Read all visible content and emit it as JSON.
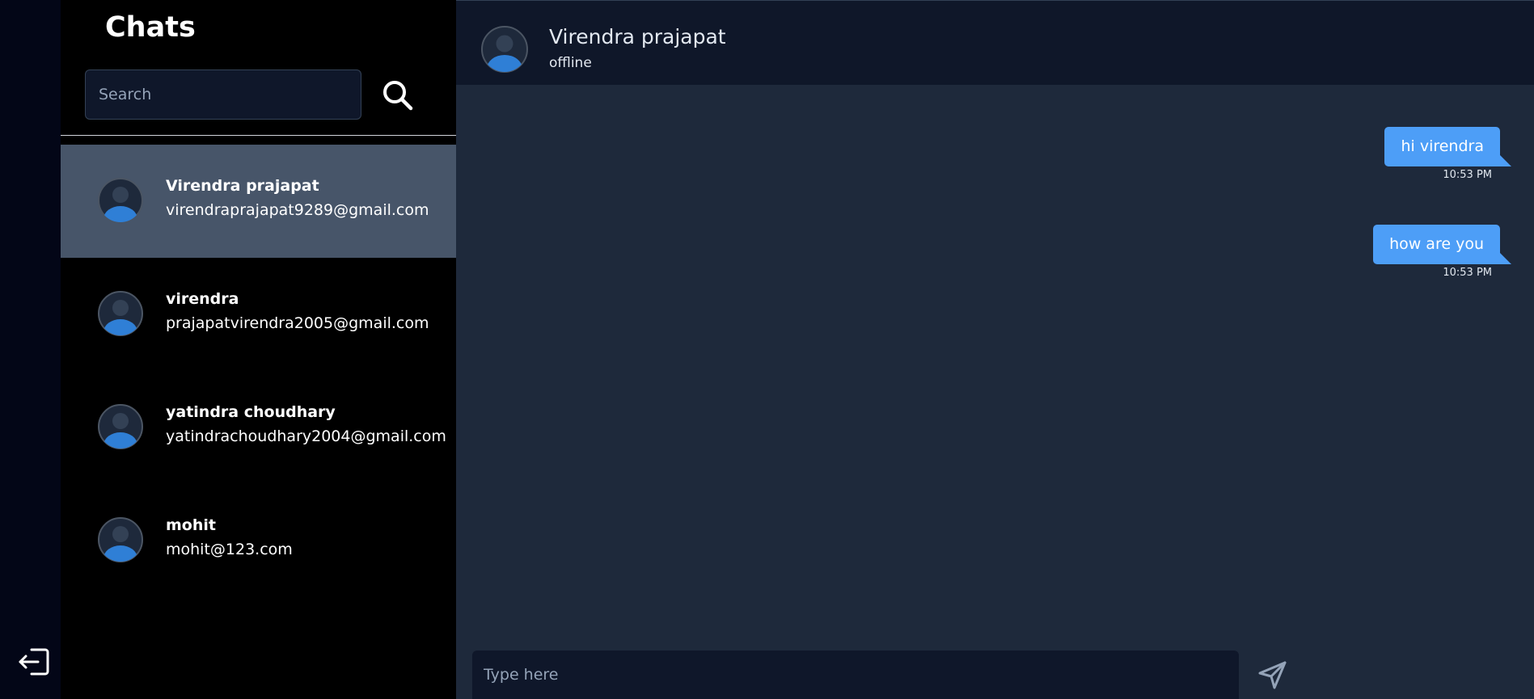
{
  "sidebar": {
    "title": "Chats",
    "search_placeholder": "Search",
    "contacts": [
      {
        "name": "Virendra prajapat",
        "email": "virendraprajapat9289@gmail.com",
        "active": true
      },
      {
        "name": "virendra",
        "email": "prajapatvirendra2005@gmail.com",
        "active": false
      },
      {
        "name": "yatindra choudhary",
        "email": "yatindrachoudhary2004@gmail.com",
        "active": false
      },
      {
        "name": "mohit",
        "email": "mohit@123.com",
        "active": false
      }
    ]
  },
  "chat": {
    "header": {
      "name": "Virendra prajapat",
      "status": "offline"
    },
    "messages": [
      {
        "text": "hi virendra",
        "time": "10:53 PM"
      },
      {
        "text": "how are you",
        "time": "10:53 PM"
      }
    ],
    "composer_placeholder": "Type here"
  },
  "icons": {
    "logout": "logout-icon",
    "search": "search-icon",
    "send": "send-icon",
    "avatar": "user-avatar-icon"
  },
  "colors": {
    "accent": "#4d9ef7",
    "active_contact": "#475569",
    "sidebar_bg": "#000000",
    "chat_bg": "#1e293b"
  }
}
